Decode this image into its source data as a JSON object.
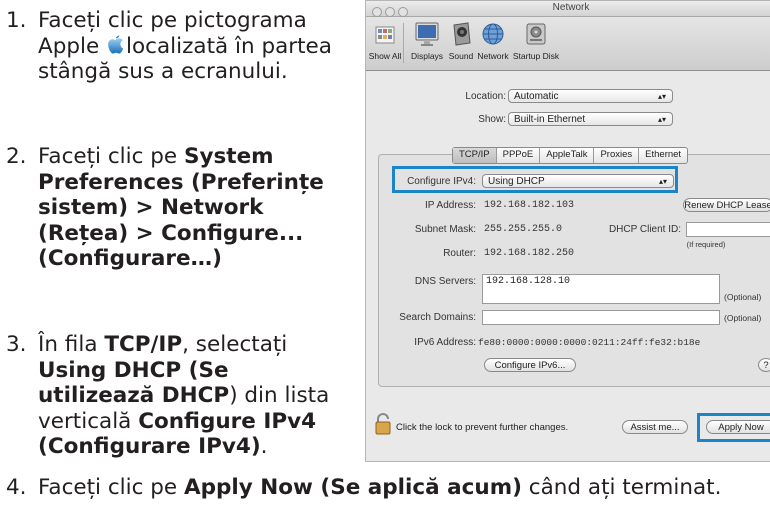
{
  "steps": [
    {
      "num": "1.",
      "pre": "Faceți clic pe pictograma Apple ",
      "post": "localizată în partea stângă sus a ecranului."
    },
    {
      "num": "2.",
      "pre": "Faceți clic pe ",
      "bold": "System Preferences (Preferințe sistem) > Network (Rețea) > Configure... (Configurare…)"
    },
    {
      "num": "3.",
      "pre": "În fila ",
      "bold1": "TCP/IP",
      "mid": ", selectați ",
      "bold2": "Using DHCP (Se utilizează DHCP",
      "mid2": ") din lista verticală ",
      "bold3": "Configure IPv4 (Configurare IPv4)",
      "end": "."
    },
    {
      "num": "4.",
      "pre": "Faceți clic pe ",
      "bold": "Apply Now (Se aplică acum)",
      "post": " când ați terminat."
    }
  ],
  "window": {
    "title": "Network",
    "toolbar": [
      {
        "label": "Show All",
        "icon": "show-all-icon"
      },
      {
        "label": "Displays",
        "icon": "displays-icon"
      },
      {
        "label": "Sound",
        "icon": "sound-icon"
      },
      {
        "label": "Network",
        "icon": "network-icon"
      },
      {
        "label": "Startup Disk",
        "icon": "startup-disk-icon"
      }
    ],
    "location_label": "Location:",
    "location_value": "Automatic",
    "show_label": "Show:",
    "show_value": "Built-in Ethernet",
    "tabs": [
      "TCP/IP",
      "PPPoE",
      "AppleTalk",
      "Proxies",
      "Ethernet"
    ],
    "configure_label": "Configure IPv4:",
    "configure_value": "Using DHCP",
    "ip_label": "IP Address:",
    "ip_value": "192.168.182.103",
    "renew_button": "Renew DHCP Lease",
    "subnet_label": "Subnet Mask:",
    "subnet_value": "255.255.255.0",
    "client_id_label": "DHCP Client ID:",
    "if_required": "(If required)",
    "router_label": "Router:",
    "router_value": "192.168.182.250",
    "dns_label": "DNS Servers:",
    "dns_value": "192.168.128.10",
    "optional1": "(Optional)",
    "search_label": "Search Domains:",
    "optional2": "(Optional)",
    "ipv6_label": "IPv6 Address:",
    "ipv6_value": "fe80:0000:0000:0000:0211:24ff:fe32:b18e",
    "configure_ipv6_button": "Configure IPv6...",
    "help_button": "?",
    "lock_text": "Click the lock to prevent further changes.",
    "assist_button": "Assist me...",
    "apply_button": "Apply Now"
  },
  "colors": {
    "highlight": "#1b85c7"
  }
}
